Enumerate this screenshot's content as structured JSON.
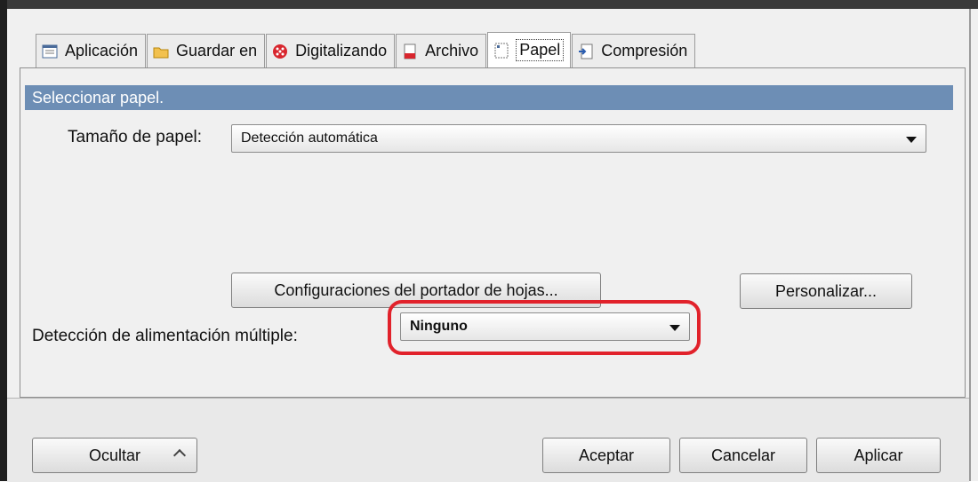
{
  "tabs": [
    {
      "label": "Aplicación",
      "icon": "application-icon"
    },
    {
      "label": "Guardar en",
      "icon": "folder-icon"
    },
    {
      "label": "Digitalizando",
      "icon": "scanning-icon"
    },
    {
      "label": "Archivo",
      "icon": "file-icon"
    },
    {
      "label": "Papel",
      "icon": "paper-icon",
      "active": true
    },
    {
      "label": "Compresión",
      "icon": "compression-icon"
    }
  ],
  "section": {
    "title": "Seleccionar papel."
  },
  "paper_size": {
    "label": "Tamaño de papel:",
    "value": "Detección automática"
  },
  "buttons": {
    "carrier_settings": "Configuraciones del portador de hojas...",
    "customize": "Personalizar..."
  },
  "multifeed": {
    "label": "Detección de alimentación múltiple:",
    "value": "Ninguno"
  },
  "footer": {
    "hide": "Ocultar",
    "accept": "Aceptar",
    "cancel": "Cancelar",
    "apply": "Aplicar"
  },
  "colors": {
    "header": "#6d8eb5",
    "highlight": "#e1222b"
  }
}
